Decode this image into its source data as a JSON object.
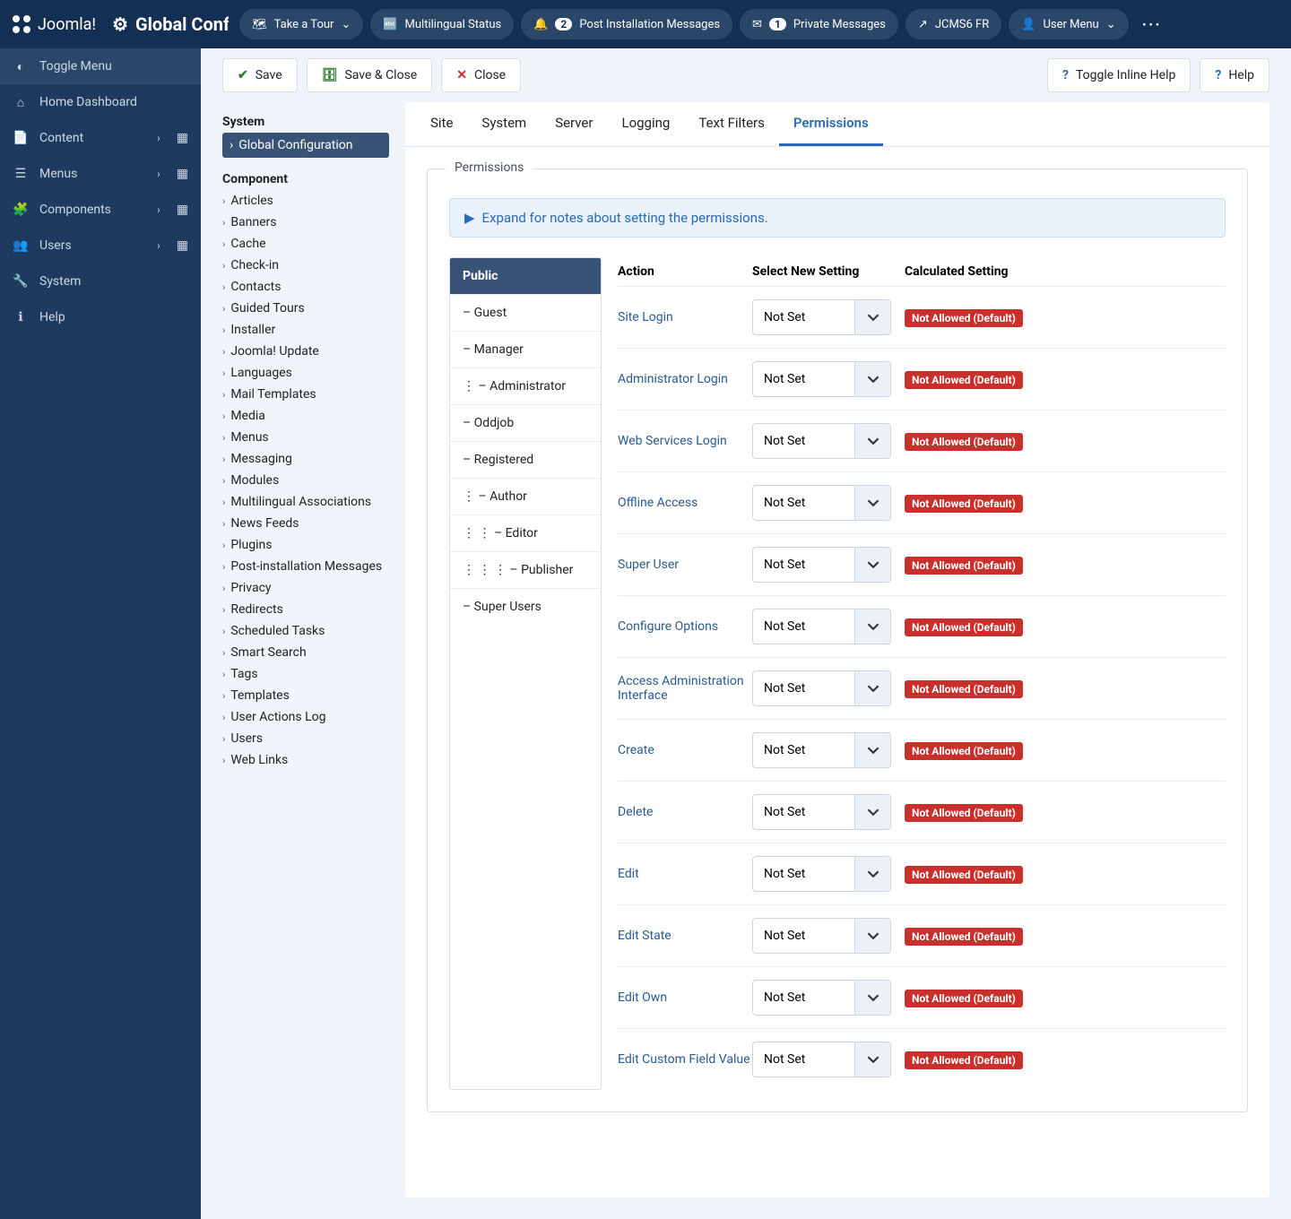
{
  "header": {
    "brand": "Joomla!",
    "page_title": "Global Conf",
    "tour": "Take a Tour",
    "multilingual": "Multilingual Status",
    "post_install_count": "2",
    "post_install": "Post Installation Messages",
    "pm_count": "1",
    "pm": "Private Messages",
    "site_link": "JCMS6 FR",
    "user_menu": "User Menu"
  },
  "sidebar": {
    "toggle": "Toggle Menu",
    "items": [
      {
        "label": "Home Dashboard",
        "icon": "⌂",
        "expand": false,
        "grid": false
      },
      {
        "label": "Content",
        "icon": "📄",
        "expand": true,
        "grid": true
      },
      {
        "label": "Menus",
        "icon": "☰",
        "expand": true,
        "grid": true
      },
      {
        "label": "Components",
        "icon": "🧩",
        "expand": true,
        "grid": true
      },
      {
        "label": "Users",
        "icon": "👥",
        "expand": true,
        "grid": true
      },
      {
        "label": "System",
        "icon": "🔧",
        "expand": false,
        "grid": false
      },
      {
        "label": "Help",
        "icon": "ℹ",
        "expand": false,
        "grid": false
      }
    ]
  },
  "toolbar": {
    "save": "Save",
    "save_close": "Save & Close",
    "close": "Close",
    "toggle_help": "Toggle Inline Help",
    "help": "Help"
  },
  "sidecol": {
    "system": "System",
    "global_config": "Global Configuration",
    "component": "Component",
    "components": [
      "Articles",
      "Banners",
      "Cache",
      "Check-in",
      "Contacts",
      "Guided Tours",
      "Installer",
      "Joomla! Update",
      "Languages",
      "Mail Templates",
      "Media",
      "Menus",
      "Messaging",
      "Modules",
      "Multilingual Associations",
      "News Feeds",
      "Plugins",
      "Post-installation Messages",
      "Privacy",
      "Redirects",
      "Scheduled Tasks",
      "Smart Search",
      "Tags",
      "Templates",
      "User Actions Log",
      "Users",
      "Web Links"
    ]
  },
  "tabs": [
    "Site",
    "System",
    "Server",
    "Logging",
    "Text Filters",
    "Permissions"
  ],
  "active_tab": "Permissions",
  "perm": {
    "legend": "Permissions",
    "expand_note": "Expand for notes about setting the permissions.",
    "groups": [
      {
        "label": "Public",
        "indent": 0,
        "active": true
      },
      {
        "label": "– Guest",
        "indent": 1
      },
      {
        "label": "– Manager",
        "indent": 1
      },
      {
        "label": "– Administrator",
        "indent": 2,
        "dots": 1
      },
      {
        "label": "– Oddjob",
        "indent": 1
      },
      {
        "label": "– Registered",
        "indent": 1
      },
      {
        "label": "– Author",
        "indent": 2,
        "dots": 1
      },
      {
        "label": "– Editor",
        "indent": 3,
        "dots": 2
      },
      {
        "label": "– Publisher",
        "indent": 4,
        "dots": 3
      },
      {
        "label": "– Super Users",
        "indent": 1
      }
    ],
    "head_action": "Action",
    "head_select": "Select New Setting",
    "head_calc": "Calculated Setting",
    "notset": "Not Set",
    "result": "Not Allowed (Default)",
    "actions": [
      "Site Login",
      "Administrator Login",
      "Web Services Login",
      "Offline Access",
      "Super User",
      "Configure Options",
      "Access Administration Interface",
      "Create",
      "Delete",
      "Edit",
      "Edit State",
      "Edit Own",
      "Edit Custom Field Value"
    ]
  }
}
